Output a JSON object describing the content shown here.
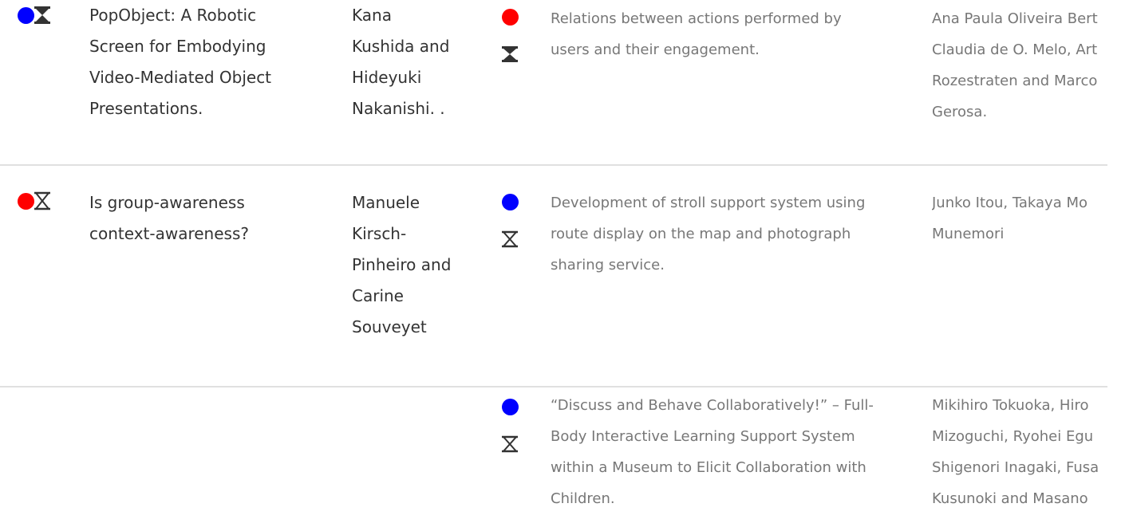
{
  "colors": {
    "red": "#ff0000",
    "blue": "#0000ff",
    "hourglass": "#333333",
    "text_primary": "#333333",
    "text_secondary": "#777777",
    "divider": "#e0e0e0"
  },
  "rows": [
    {
      "status_dot": "blue",
      "hourglass": "filled",
      "title": "PopObject: A Robotic\nScreen for Embodying\nVideo-Mediated Object\nPresentations.",
      "authors": "Kana\nKushida and\nHideyuki\nNakanishi. .",
      "related": {
        "status_dot": "red",
        "hourglass": "filled",
        "title": "Relations between actions performed by\nusers and their engagement.",
        "authors": "Ana Paula Oliveira Bert\nClaudia de O. Melo, Art\nRozestraten and Marco\nGerosa."
      }
    },
    {
      "status_dot": "red",
      "hourglass": "outline",
      "title": "Is group-awareness\ncontext-awareness?",
      "authors": "Manuele\nKirsch-\nPinheiro and\nCarine\nSouveyet",
      "related": {
        "status_dot": "blue",
        "hourglass": "outline",
        "title": "Development of stroll support system using\nroute display on the map and photograph\nsharing service.",
        "authors": "Junko Itou, Takaya Mo\nMunemori"
      }
    },
    {
      "related": {
        "status_dot": "blue",
        "hourglass": "outline",
        "title": "“Discuss and Behave Collaboratively!” – Full-\nBody Interactive Learning Support System\nwithin a Museum to Elicit Collaboration with\nChildren.",
        "authors": "Mikihiro Tokuoka, Hiro\nMizoguchi, Ryohei Egu\nShigenori Inagaki, Fusa\nKusunoki and Masano"
      }
    }
  ]
}
